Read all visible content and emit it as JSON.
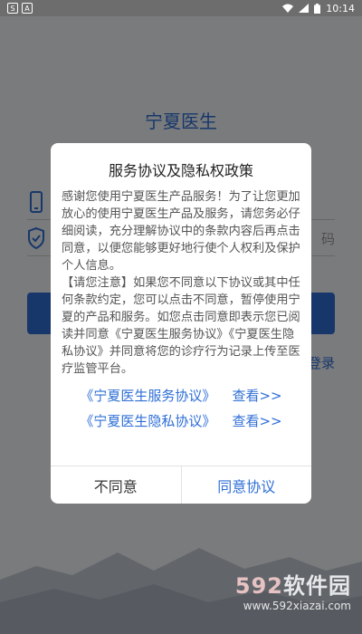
{
  "status_bar": {
    "left_icons": [
      "S",
      "A"
    ],
    "time": "10:14"
  },
  "app": {
    "title": "宁夏医生",
    "code_hint": "码",
    "password_login": "登录"
  },
  "dialog": {
    "title": "服务协议及隐私权政策",
    "paragraph1": "感谢您使用宁夏医生产品服务！为了让您更加放心的使用宁夏医生产品及服务，请您务必仔细阅读，充分理解协议中的条款内容后再点击同意，以便您能够更好地行使个人权利及保护个人信息。",
    "paragraph2": "【请您注意】如果您不同意以下协议或其中任何条款约定，您可以点击不同意，暂停使用宁夏的产品和服务。如您点击同意即表示您已阅读并同意《宁夏医生服务协议》《宁夏医生隐私协议》并同意将您的诊疗行为记录上传至医疗监管平台。",
    "agreements": [
      {
        "name": "《宁夏医生服务协议》",
        "view": "查看>>"
      },
      {
        "name": "《宁夏医生隐私协议》",
        "view": "查看>>"
      }
    ],
    "decline": "不同意",
    "accept": "同意协议"
  },
  "watermark": {
    "logo_num": "592",
    "logo_text": "软件园",
    "url": "www.592xiazai.com"
  },
  "colors": {
    "accent": "#2f6fd6",
    "overlay": "rgba(0,0,0,0.5)"
  }
}
